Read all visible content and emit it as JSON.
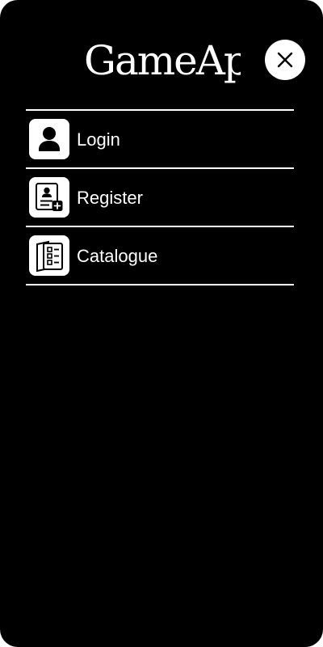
{
  "app": {
    "logo_text": "GameApp"
  },
  "header": {
    "close_icon": "close-icon"
  },
  "menu": {
    "items": [
      {
        "label": "Login",
        "icon": "user-icon"
      },
      {
        "label": "Register",
        "icon": "register-icon"
      },
      {
        "label": "Catalogue",
        "icon": "catalogue-icon"
      }
    ]
  },
  "colors": {
    "background": "#000000",
    "foreground": "#ffffff"
  }
}
